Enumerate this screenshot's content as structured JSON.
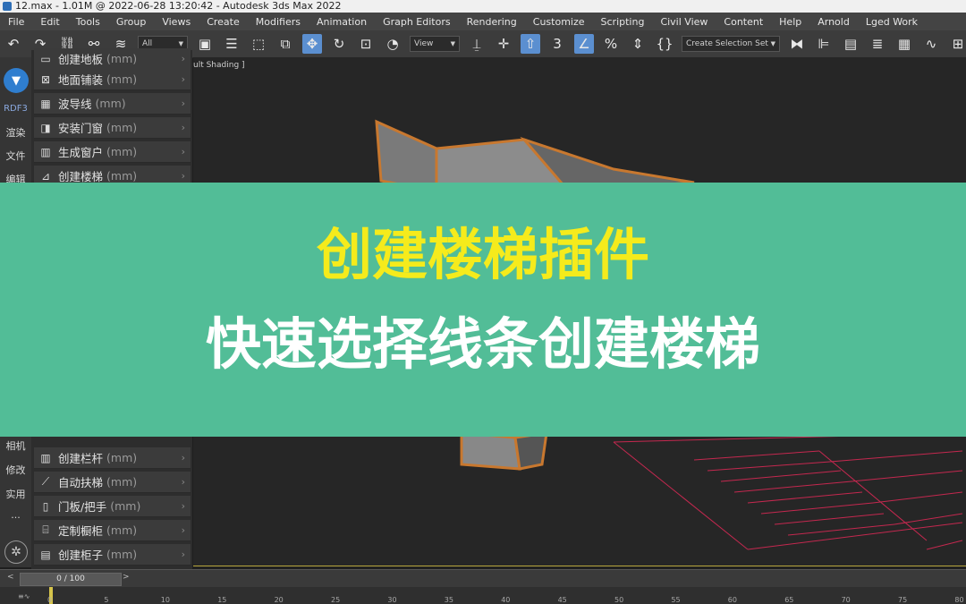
{
  "window": {
    "title": "12.max - 1.01M @ 2022-06-28 13:20:42 - Autodesk 3ds Max 2022"
  },
  "menu": [
    "File",
    "Edit",
    "Tools",
    "Group",
    "Views",
    "Create",
    "Modifiers",
    "Animation",
    "Graph Editors",
    "Rendering",
    "Customize",
    "Scripting",
    "Civil View",
    "Content",
    "Help",
    "Arnold",
    "Lged Work"
  ],
  "toolbar": {
    "filter_value": "All",
    "view_value": "View",
    "selection_set_value": "Create Selection Set"
  },
  "left_strip": {
    "brand": "RDF3",
    "items": [
      "渲染",
      "文件",
      "编辑",
      "相机",
      "修改",
      "实用"
    ],
    "more": "···"
  },
  "panel": {
    "items": [
      {
        "label": "创建地板",
        "unit": "(mm)",
        "icon": "floor-icon"
      },
      {
        "label": "地面铺装",
        "unit": "(mm)",
        "icon": "paving-icon"
      },
      {
        "label": "波导线",
        "unit": "(mm)",
        "icon": "waveguide-icon"
      },
      {
        "label": "安装门窗",
        "unit": "(mm)",
        "icon": "door-icon"
      },
      {
        "label": "生成窗户",
        "unit": "(mm)",
        "icon": "window-icon"
      },
      {
        "label": "创建楼梯",
        "unit": "(mm)",
        "icon": "stairs-icon"
      },
      {
        "label": "创建栏杆",
        "unit": "(mm)",
        "icon": "railing-icon"
      },
      {
        "label": "自动扶梯",
        "unit": "(mm)",
        "icon": "escalator-icon"
      },
      {
        "label": "门板/把手",
        "unit": "(mm)",
        "icon": "door-panel-icon"
      },
      {
        "label": "定制橱柜",
        "unit": "(mm)",
        "icon": "cabinet-icon"
      },
      {
        "label": "创建柜子",
        "unit": "(mm)",
        "icon": "cupboard-icon"
      }
    ]
  },
  "viewport": {
    "label": "ult Shading ]"
  },
  "banner": {
    "line1": "创建楼梯插件",
    "line2": "快速选择线条创建楼梯",
    "line1_color": "#f5eb1c",
    "line2_color": "#ffffff",
    "bg_color": "#52bd97"
  },
  "timeline": {
    "frame_text": "0 / 100",
    "ruler_labels": [
      "0",
      "5",
      "10",
      "15",
      "20",
      "25",
      "30",
      "35",
      "40",
      "45",
      "50",
      "55",
      "60",
      "65",
      "70",
      "75",
      "80"
    ],
    "left_label": "≡∿"
  }
}
